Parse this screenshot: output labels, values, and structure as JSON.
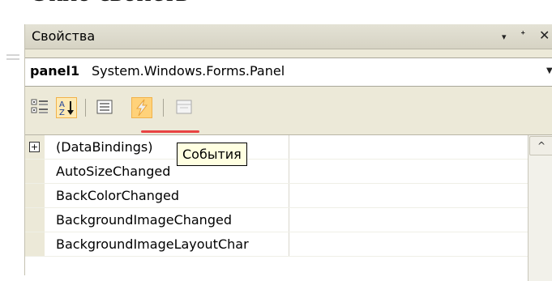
{
  "page_caption": "Окно свойств",
  "window": {
    "title": "Свойства",
    "controls": {
      "dropdown": "▾",
      "pin": "ᐩ",
      "close": "✕"
    }
  },
  "object_selector": {
    "name": "panel1",
    "type": "System.Windows.Forms.Panel",
    "dropdown_icon": "chevron-down-icon"
  },
  "toolbar": {
    "buttons": [
      {
        "name": "categorized",
        "icon": "categorized-icon",
        "active": false
      },
      {
        "name": "alphabetical",
        "icon": "alphabetical-sort-icon",
        "active": true
      },
      {
        "name": "properties",
        "icon": "properties-icon",
        "active": false
      },
      {
        "name": "events",
        "icon": "events-lightning-icon",
        "active": true
      },
      {
        "name": "property-pages",
        "icon": "property-pages-icon",
        "active": false
      }
    ]
  },
  "tooltip": {
    "text": "События"
  },
  "grid": {
    "rows": [
      {
        "name": "(DataBindings)",
        "expandable": true,
        "expander": "+"
      },
      {
        "name": "AutoSizeChanged",
        "expandable": false
      },
      {
        "name": "BackColorChanged",
        "expandable": false
      },
      {
        "name": "BackgroundImageChanged",
        "expandable": false
      },
      {
        "name": "BackgroundImageLayoutChar",
        "expandable": false
      }
    ]
  },
  "scrollbar": {
    "up_arrow": "^"
  },
  "colors": {
    "highlight_underline": "#e84343",
    "tooltip_bg": "#ffffe1",
    "active_button": "#ffd27a"
  }
}
